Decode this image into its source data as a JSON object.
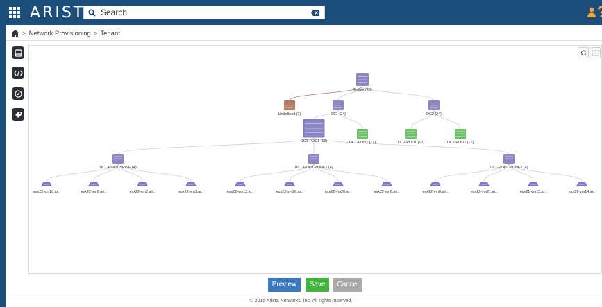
{
  "header": {
    "brand": "ARISTA",
    "search_placeholder": "Search",
    "icons": [
      "apps-grid-icon",
      "search-icon",
      "clear-icon",
      "user-icon",
      "help-icon"
    ]
  },
  "breadcrumb": {
    "items": [
      "Network Provisioning",
      "Tenant"
    ]
  },
  "side_tools": [
    "device-icon",
    "code-icon",
    "compass-icon",
    "tag-icon"
  ],
  "canvas_tools": [
    "refresh-icon",
    "list-icon"
  ],
  "topology": {
    "nodes": [
      {
        "id": "tenant",
        "label": "Tenant (48)",
        "kind": "tenant"
      },
      {
        "id": "undefined",
        "label": "Undefined (7)",
        "kind": "undefined"
      },
      {
        "id": "dc1",
        "label": "DC1 (24)",
        "kind": "container"
      },
      {
        "id": "dc2",
        "label": "DC2 (24)",
        "kind": "container"
      },
      {
        "id": "dc1pod1",
        "label": "DC1-POD1 (12)",
        "kind": "selected"
      },
      {
        "id": "dc1pod2",
        "label": "DC1-POD2 (12)",
        "kind": "pod"
      },
      {
        "id": "dc2pod1",
        "label": "DC2-POD1 (12)",
        "kind": "pod"
      },
      {
        "id": "dc2pod2",
        "label": "DC2-POD2 (12)",
        "kind": "pod"
      },
      {
        "id": "spine",
        "label": "DC1-POD1-SPINE (4)",
        "kind": "container"
      },
      {
        "id": "zone1",
        "label": "DC1-POD1-ZONE1 (4)",
        "kind": "container"
      },
      {
        "id": "zone2",
        "label": "DC1-POD1-ZONE2 (4)",
        "kind": "container"
      },
      {
        "id": "l1",
        "label": "esx22-vm10.ar..",
        "kind": "leaf"
      },
      {
        "id": "l2",
        "label": "esx22-vm8.ari..",
        "kind": "leaf"
      },
      {
        "id": "l3",
        "label": "esx22-vm2.ari..",
        "kind": "leaf"
      },
      {
        "id": "l4",
        "label": "esx22-vm1.ar..",
        "kind": "leaf"
      },
      {
        "id": "l5",
        "label": "esx22-vm12.ar..",
        "kind": "leaf"
      },
      {
        "id": "l6",
        "label": "esx22-vm26.ar..",
        "kind": "leaf"
      },
      {
        "id": "l7",
        "label": "esx22-vm20.ar..",
        "kind": "leaf"
      },
      {
        "id": "l8",
        "label": "esx22-vm6.ari..",
        "kind": "leaf"
      },
      {
        "id": "l9",
        "label": "esx22-vm0.ari..",
        "kind": "leaf"
      },
      {
        "id": "l10",
        "label": "esx22-vm21.ar..",
        "kind": "leaf"
      },
      {
        "id": "l11",
        "label": "esx21-vm13.ar..",
        "kind": "leaf"
      },
      {
        "id": "l12",
        "label": "esx21-vm14.ar..",
        "kind": "leaf"
      }
    ],
    "edges": [
      [
        "tenant",
        "undefined"
      ],
      [
        "tenant",
        "dc1"
      ],
      [
        "tenant",
        "dc2"
      ],
      [
        "dc1",
        "dc1pod1"
      ],
      [
        "dc1",
        "dc1pod2"
      ],
      [
        "dc2",
        "dc2pod1"
      ],
      [
        "dc2",
        "dc2pod2"
      ],
      [
        "dc1pod1",
        "spine"
      ],
      [
        "dc1pod1",
        "zone1"
      ],
      [
        "dc1pod1",
        "zone2"
      ],
      [
        "spine",
        "l1"
      ],
      [
        "spine",
        "l2"
      ],
      [
        "spine",
        "l3"
      ],
      [
        "spine",
        "l4"
      ],
      [
        "zone1",
        "l5"
      ],
      [
        "zone1",
        "l6"
      ],
      [
        "zone1",
        "l7"
      ],
      [
        "zone1",
        "l8"
      ],
      [
        "zone2",
        "l9"
      ],
      [
        "zone2",
        "l10"
      ],
      [
        "zone2",
        "l11"
      ],
      [
        "zone2",
        "l12"
      ]
    ],
    "colors": {
      "container": "#8d86c4",
      "undefined": "#b5775e",
      "pod": "#6fc06a",
      "leaf": "#8474cf",
      "edge": "#cfcfcf",
      "undefined_edge": "#b5775e"
    }
  },
  "actions": {
    "preview": "Preview",
    "save": "Save",
    "cancel": "Cancel"
  },
  "footer": "© 2015 Arista Networks, Inc. All rights reserved."
}
